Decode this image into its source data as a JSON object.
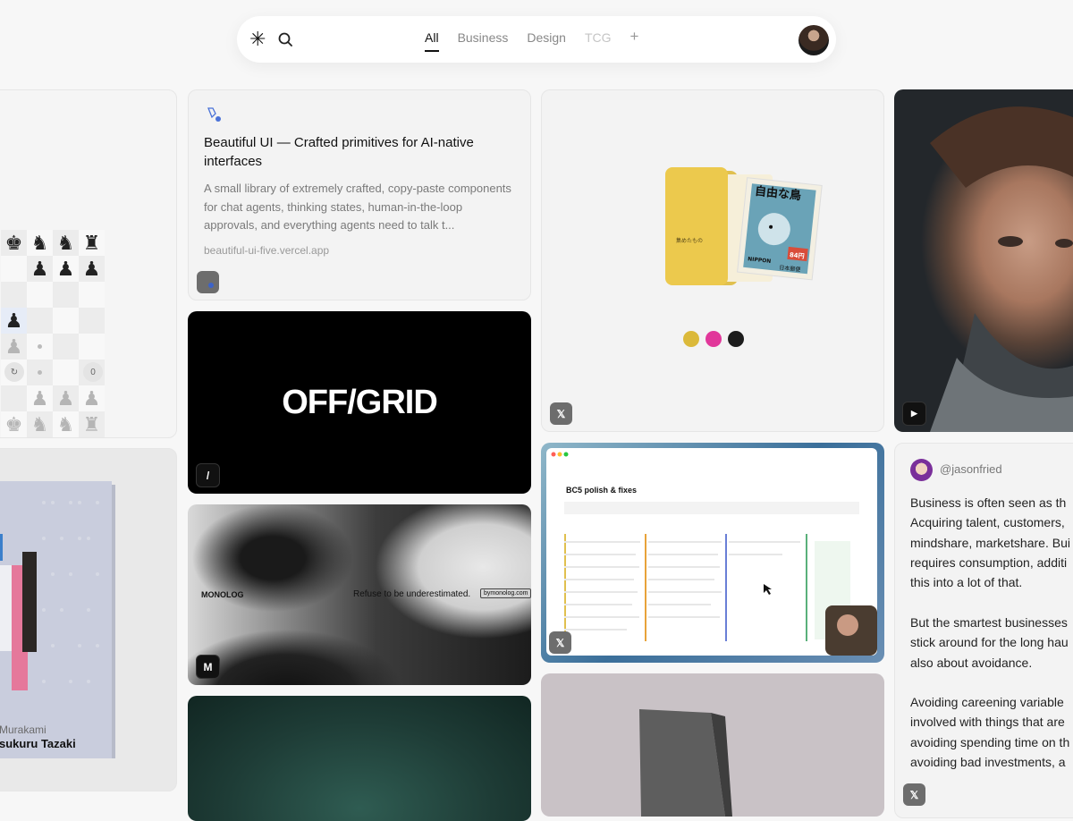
{
  "nav": {
    "logo_glyph": "✳",
    "tabs": [
      "All",
      "Business",
      "Design",
      "TCG"
    ],
    "active_tab": "All",
    "add_glyph": "+"
  },
  "chess_card": {
    "rows": [
      [
        "♚",
        "♞",
        "♞",
        "♜"
      ],
      [
        "",
        "♟",
        "♟",
        "♟"
      ],
      [
        "",
        "",
        "",
        ""
      ],
      [
        "♟",
        "",
        "",
        ""
      ],
      [
        "♟",
        "•",
        "",
        ""
      ],
      [
        "",
        "•",
        "",
        ""
      ],
      [
        "",
        "♟",
        "♟",
        "♟"
      ],
      [
        "♚",
        "♞",
        "♞",
        "♜"
      ]
    ],
    "counter": "0"
  },
  "beautiful_ui": {
    "title": "Beautiful UI — Crafted primitives for AI-native interfaces",
    "description": "A small library of extremely crafted, copy-paste components for chat agents, thinking states, human-in-the-loop approvals, and everything agents need to talk t...",
    "url": "beautiful-ui-five.vercel.app"
  },
  "offgrid": {
    "title": "OFF/GRID",
    "badge": "/"
  },
  "monolog": {
    "logo": "MONOLOG",
    "tagline": "Refuse to be underestimated.",
    "link": "bymonolog.com",
    "badge": "M"
  },
  "folder_card": {
    "folder_text": "集めたもの",
    "stamp_title": "自由な鳥",
    "stamp_country": "NIPPON",
    "stamp_price": "84円",
    "stamp_post": "日本郵便",
    "swatches": [
      "#dbb93a",
      "#e1379a",
      "#1c1c1c"
    ],
    "badge": "𝕏"
  },
  "bc5_card": {
    "title": "BC5 polish & fixes",
    "badge": "𝕏"
  },
  "portrait_card": {
    "badge": "▶"
  },
  "tweet": {
    "handle": "@jasonfried",
    "p1": "Business is often seen as th\nAcquiring talent, customers,\nmindshare, marketshare. Bui\nrequires consumption, additi\nthis into a lot of that.",
    "p2": "But the smartest businesses\nstick around for the long hau\nalso about avoidance.",
    "p3": "Avoiding careening variable\ninvolved with things that are\navoiding spending time on th\navoiding bad investments, a",
    "badge": "𝕏"
  },
  "book_card": {
    "author": "Murakami",
    "title": "sukuru Tazaki"
  }
}
